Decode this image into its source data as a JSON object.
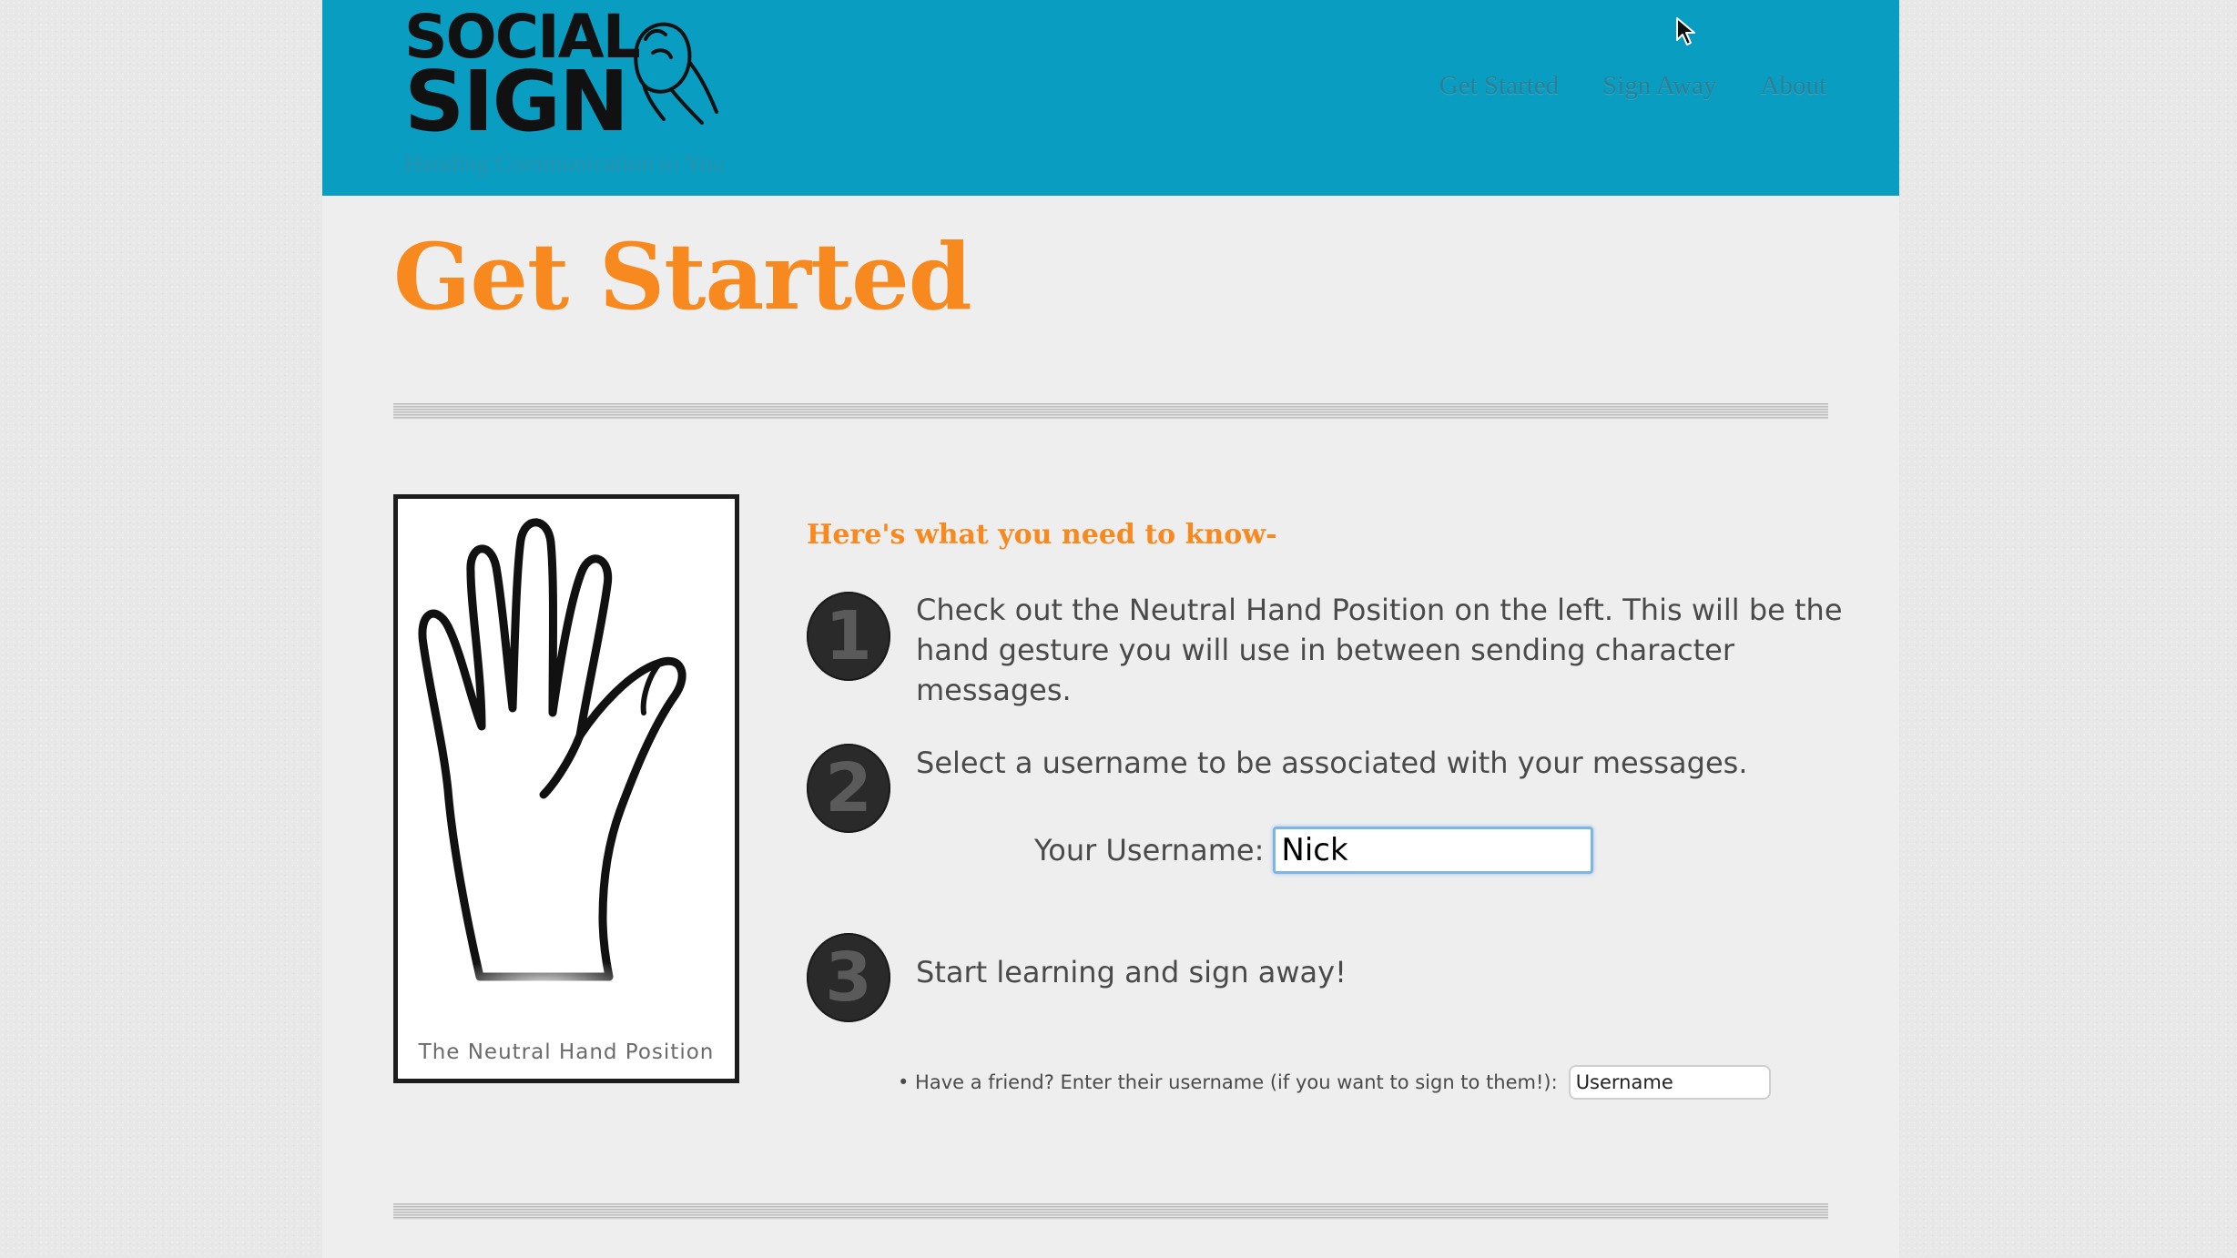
{
  "header": {
    "logo_line1": "SOCIAL",
    "logo_line2": "SIGN",
    "tagline": "Handing Communication to You",
    "nav": [
      {
        "label": "Get Started"
      },
      {
        "label": "Sign Away"
      },
      {
        "label": "About"
      }
    ],
    "background_color": "#0a9dc2"
  },
  "main": {
    "title": "Get Started",
    "title_color": "#f7891f",
    "hand_card": {
      "caption": "The Neutral Hand Position"
    },
    "steps_heading": "Here's what you need to know-",
    "steps": [
      {
        "number": "1",
        "text": "Check out the Neutral Hand Position on the left. This will be the hand gesture you will use in between sending character messages."
      },
      {
        "number": "2",
        "text": "Select a username to be associated with your messages."
      },
      {
        "number": "3",
        "text": "Start learning and sign away!"
      }
    ],
    "username": {
      "label": "Your Username:",
      "value": "Nick"
    },
    "friend": {
      "text": "• Have a friend? Enter their username (if you want to sign to them!):",
      "placeholder": "Username"
    }
  }
}
